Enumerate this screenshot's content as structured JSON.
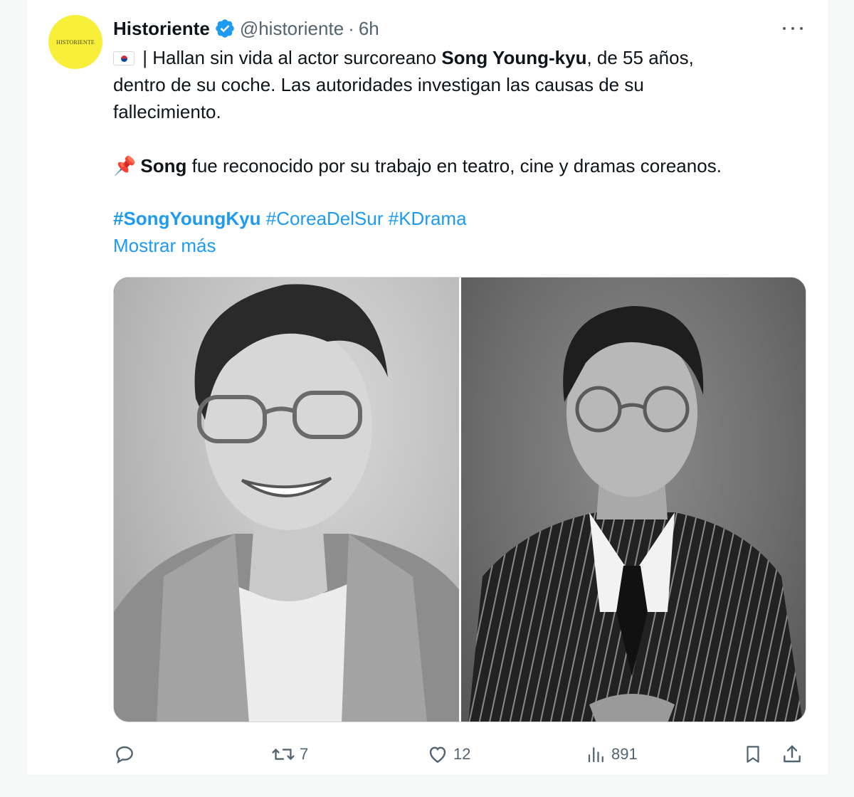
{
  "tweet": {
    "avatar_text": "HISTORIENTE",
    "author_name": "Historiente",
    "handle": "@historiente",
    "separator": "·",
    "time": "6h",
    "text": {
      "p1_a": " | Hallan sin vida al actor surcoreano ",
      "p1_bold": "Song Young-kyu",
      "p1_b": ", de 55 años,\ndentro de su coche. Las autoridades investigan las causas de su\nfallecimiento.",
      "p2_bold": "Song",
      "p2_rest": " fue reconocido por su trabajo en teatro, cine y dramas coreanos."
    },
    "hashtags": [
      "#SongYoungKyu",
      "#CoreaDelSur",
      "#KDrama"
    ],
    "show_more": "Mostrar más",
    "icons": {
      "verified": "verified-badge-icon",
      "more": "more-options-icon",
      "flag": "south-korea-flag-icon",
      "pin": "pushpin-icon",
      "reply": "reply-icon",
      "retweet": "retweet-icon",
      "like": "like-icon",
      "views": "views-icon",
      "bookmark": "bookmark-icon",
      "share": "share-icon"
    },
    "stats": {
      "replies": "",
      "retweets": "7",
      "likes": "12",
      "views": "891"
    },
    "colors": {
      "accent": "#1d9bf0",
      "muted": "#536471",
      "avatar_bg": "#f7ef3a"
    }
  }
}
